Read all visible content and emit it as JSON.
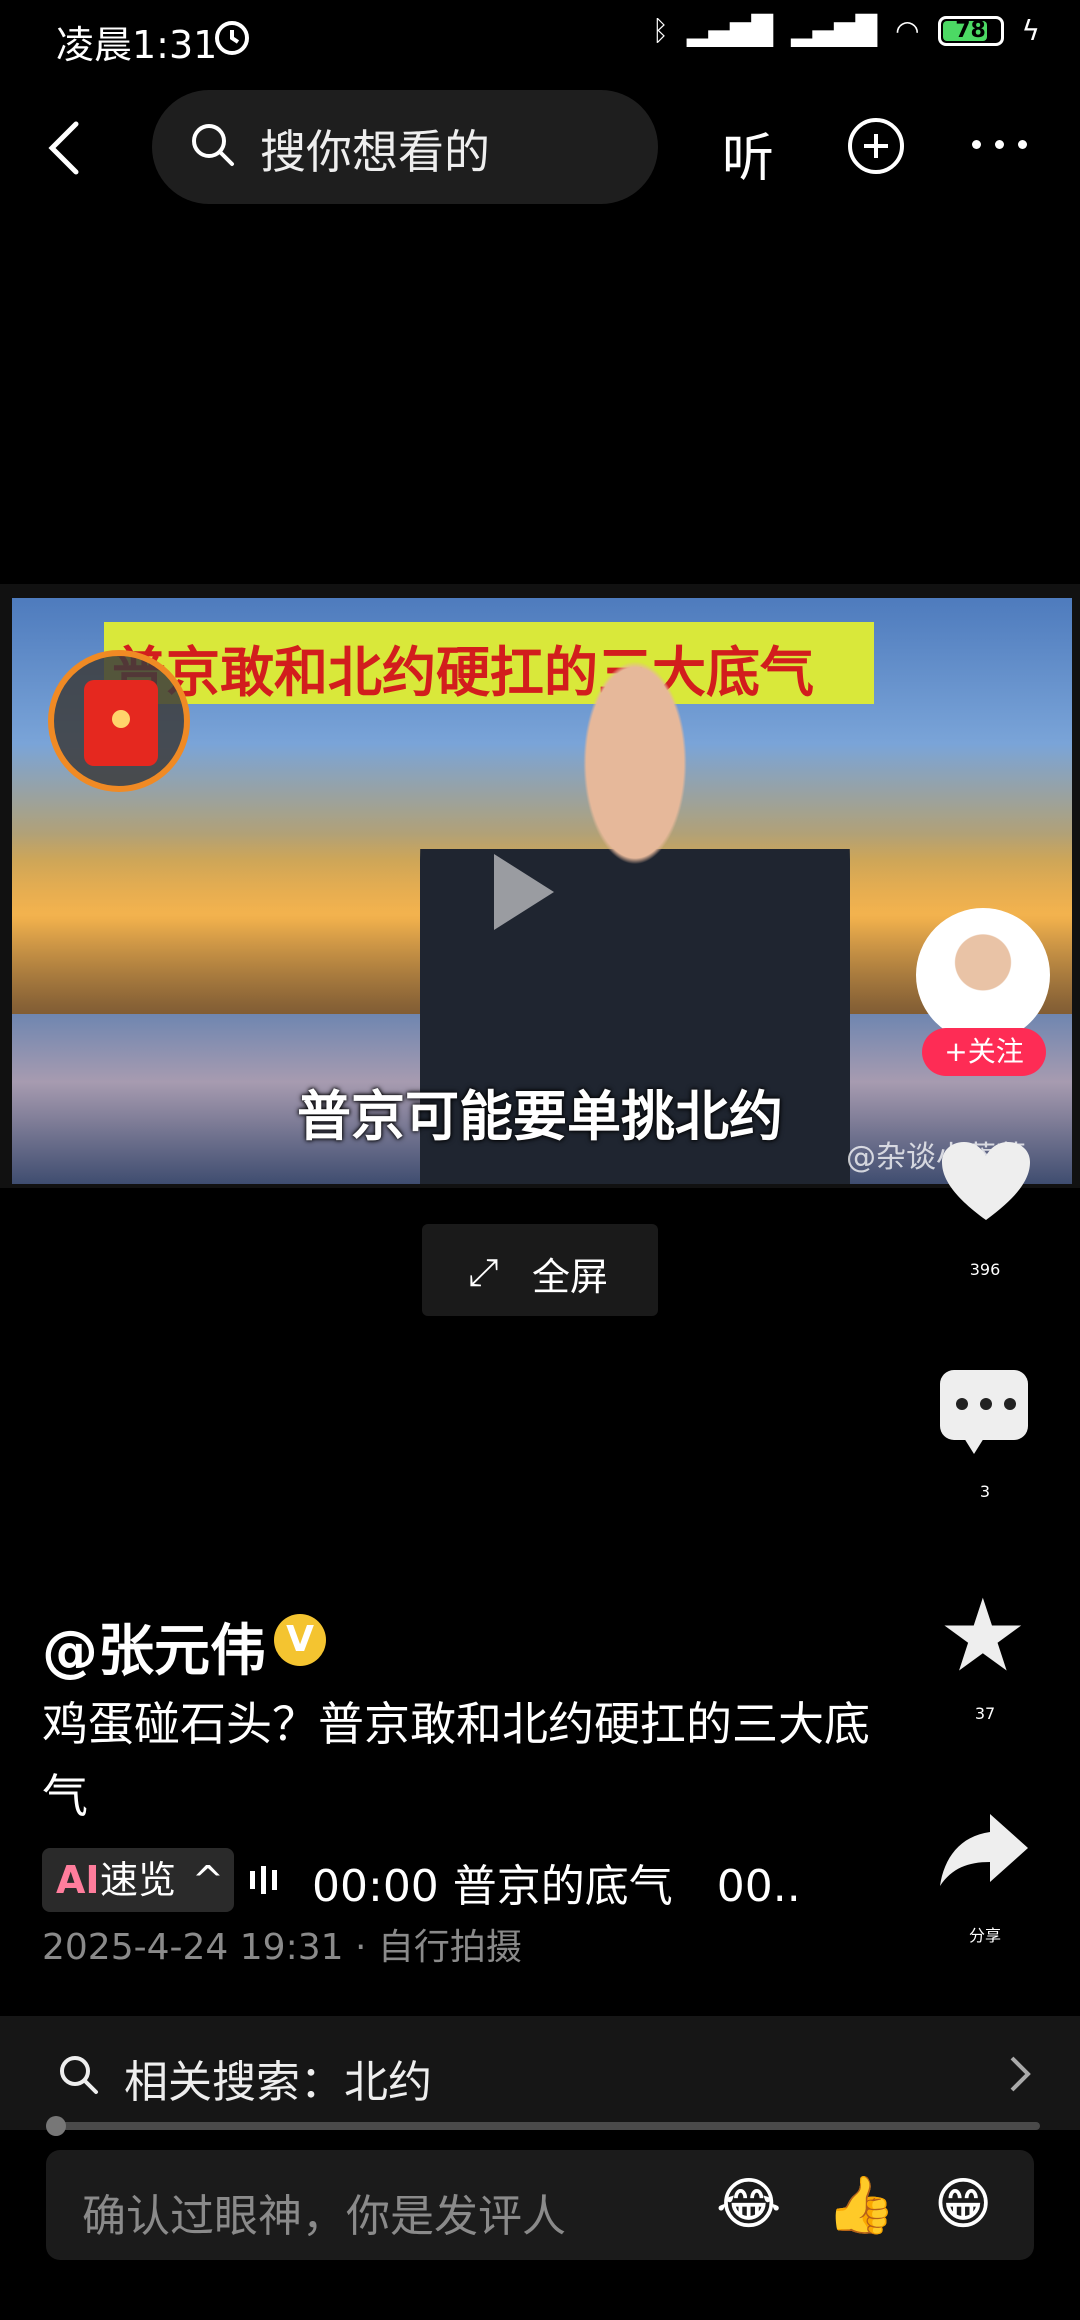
{
  "status_bar": {
    "time": "凌晨1:31",
    "battery": "78",
    "battery_level": 0.78
  },
  "nav": {
    "search_placeholder": "搜你想看的",
    "listen_label": "听"
  },
  "video": {
    "banner_title": "普京敢和北约硬扛的三大底气",
    "subtitle": "普京可能要单挑北约",
    "watermark": "@杂谈小蔡菜"
  },
  "follow_label": "+关注",
  "fullscreen_label": "全屏",
  "actions": {
    "likes": "396",
    "comments": "3",
    "favorites": "37",
    "share_label": "分享"
  },
  "post": {
    "author": "@张元伟",
    "verified_badge": "V",
    "title": "鸡蛋碰石头？普京敢和北约硬扛的三大底气",
    "ai_label_ai": "AI",
    "ai_label": "速览",
    "chapter": "00:00 普京的底气　00..",
    "meta": "2025-4-24 19:31 · 自行拍摄"
  },
  "related_search": "相关搜索：北约",
  "comment_placeholder": "确认过眼神，你是发评人",
  "emojis": [
    "😂",
    "👍",
    "😁"
  ],
  "colors": {
    "accent": "#fe2c55",
    "banner_bg": "#d9e83a",
    "banner_text": "#d21d1d"
  }
}
